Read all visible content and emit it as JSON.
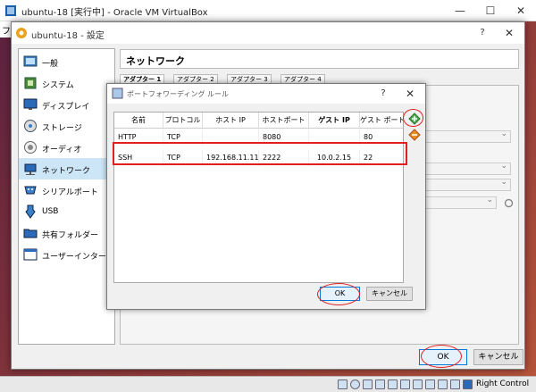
{
  "outer_window": {
    "title": "ubuntu-18 [実行中] - Oracle VM VirtualBox",
    "menu_fragment": "フ",
    "minimize": "—",
    "maximize": "☐",
    "close": "✕"
  },
  "settings_dialog": {
    "title": "ubuntu-18 - 設定",
    "help": "?",
    "close": "✕",
    "section_title": "ネットワーク",
    "tabs": [
      "アダプター 1",
      "アダプター 2",
      "アダプター 3",
      "アダプター 4"
    ],
    "sidebar": [
      {
        "label": "一般",
        "icon": "general-icon"
      },
      {
        "label": "システム",
        "icon": "system-icon"
      },
      {
        "label": "ディスプレイ",
        "icon": "display-icon"
      },
      {
        "label": "ストレージ",
        "icon": "storage-icon"
      },
      {
        "label": "オーディオ",
        "icon": "audio-icon"
      },
      {
        "label": "ネットワーク",
        "icon": "network-icon",
        "selected": true
      },
      {
        "label": "シリアルポート",
        "icon": "serial-port-icon"
      },
      {
        "label": "USB",
        "icon": "usb-icon"
      },
      {
        "label": "共有フォルダー",
        "icon": "shared-folder-icon"
      },
      {
        "label": "ユーザーインターフェース",
        "icon": "user-interface-icon"
      }
    ],
    "ok": "OK",
    "cancel": "キャンセル"
  },
  "port_forwarding_dialog": {
    "title": "ポートフォワーディング ルール",
    "help": "?",
    "close": "✕",
    "columns": [
      "名前",
      "プロトコル",
      "ホスト IP",
      "ホストポート",
      "ゲスト IP",
      "ゲスト ポート"
    ],
    "rows": [
      [
        "HTTP",
        "TCP",
        "",
        "8080",
        "",
        "80"
      ],
      [
        "SSH",
        "TCP",
        "192.168.11.11",
        "2222",
        "10.0.2.15",
        "22"
      ]
    ],
    "ok": "OK",
    "cancel": "キャンセル"
  },
  "status_bar": {
    "host_key": "Right Control"
  },
  "colors": {
    "annotation_red": "#e02020",
    "selection_blue": "#cde6f7",
    "default_button_border": "#0078d7"
  }
}
